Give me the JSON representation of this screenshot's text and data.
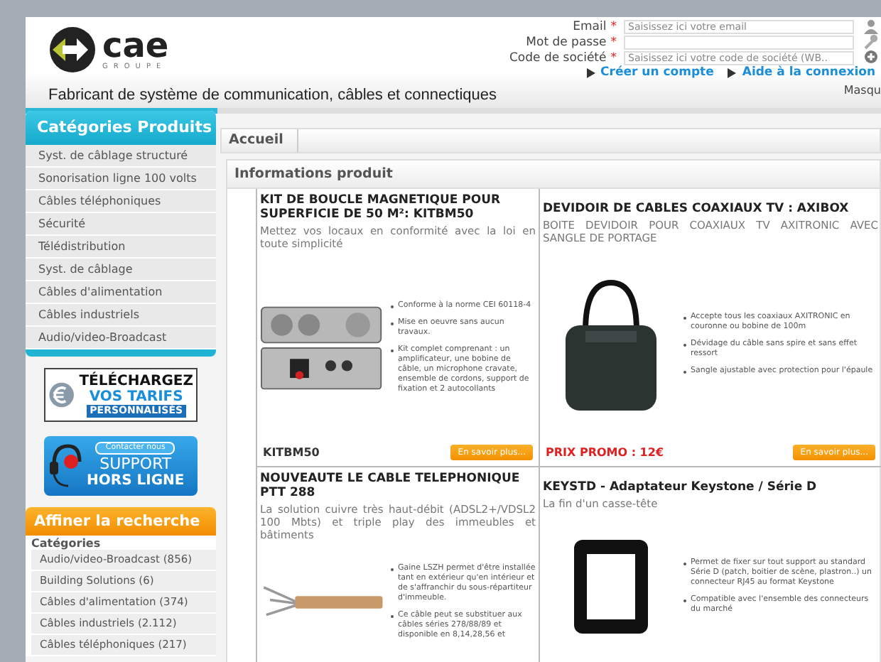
{
  "header": {
    "logo": {
      "word": "cae",
      "sub": "GROUPE"
    },
    "tagline": "Fabricant de système de communication, câbles et connectiques",
    "login": {
      "fields": [
        {
          "label": "Email",
          "mark": "*",
          "placeholder": "Saisissez ici votre email"
        },
        {
          "label": "Mot de passe",
          "mark": "*"
        },
        {
          "label": "Code de société",
          "mark": "*",
          "placeholder": "Saisissez ici votre code de société (WB.."
        }
      ],
      "links": [
        "Créer un compte",
        "Aide à la connexion"
      ]
    },
    "hide_link": "Masqu"
  },
  "sidebar": {
    "categories": {
      "title": "Catégories Produits",
      "items": [
        "Syst. de câblage structuré",
        "Sonorisation ligne 100 volts",
        "Câbles téléphoniques",
        "Sécurité",
        "Télédistribution",
        "Syst. de câblage",
        "Câbles d'alimentation",
        "Câbles industriels",
        "Audio/video-Broadcast"
      ]
    },
    "banners": [
      {
        "kind": "tarifs",
        "lines": [
          "TÉLÉCHARGEZ",
          "VOS TARIFS",
          "PERSONNALISÉS"
        ]
      },
      {
        "kind": "support",
        "lines": [
          "Contacter nous",
          "SUPPORT",
          "HORS LIGNE"
        ]
      }
    ],
    "refine": {
      "title": "Affiner la recherche",
      "section": "Catégories",
      "items": [
        "Audio/video-Broadcast (856)",
        "Building Solutions (6)",
        "Câbles d'alimentation (374)",
        "Câbles industriels (2.112)",
        "Câbles téléphoniques (217)"
      ]
    }
  },
  "content": {
    "breadcrumb": [
      "Accueil"
    ],
    "panel_title": "Informations produit",
    "products": [
      {
        "title": "KIT DE BOUCLE MAGNETIQUE POUR SUPERFICIE DE 50 M²: KITBM50",
        "subtitle": "Mettez vos locaux en conformité avec la loi en toute simplicité",
        "kind": "amplifier",
        "bullets": [
          "Conforme à la norme CEI 60118-4",
          "Mise en oeuvre sans aucun travaux.",
          "Kit complet comprenant : un amplificateur, une bobine de câble, un microphone cravate, ensemble de cordons, support de fixation et 2 autocollants"
        ],
        "code": "KITBM50",
        "button": "En savoir plus..."
      },
      {
        "title": "DEVIDOIR DE CABLES COAXIAUX TV : AXIBOX",
        "subtitle": "BOITE DEVIDOIR POUR COAXIAUX TV AXITRONIC AVEC SANGLE DE PORTAGE",
        "kind": "bag",
        "bullets": [
          "Accepte tous les coaxiaux AXITRONIC en couronne ou bobine de 100m",
          "Dévidage du câble sans spire et sans effet ressort",
          "Sangle ajustable avec protection pour l'épaule"
        ],
        "price": "PRIX PROMO : 12€",
        "button": "En savoir plus..."
      },
      {
        "title": "NOUVEAUTE LE CABLE TELEPHONIQUE PTT 288",
        "subtitle": "La solution cuivre très haut-débit (ADSL2+/VDSL2 100 Mbts) et triple play des immeubles et bâtiments",
        "kind": "cable",
        "bullets": [
          "Gaine LSZH permet d'être installée tant en extérieur qu'en intérieur et de s'affranchir du sous-répartiteur d'immeuble.",
          "Ce câble peut se substituer aux câbles séries 278/88/89 et disponible en 8,14,28,56 et"
        ]
      },
      {
        "title": "KEYSTD - Adaptateur Keystone / Série D",
        "subtitle": "La fin d'un casse-tête",
        "kind": "frame",
        "bullets": [
          "Permet de fixer sur tout support au standard Série D (patch, boitier de scène, plastron..) un connecteur RJ45 au format Keystone",
          "Compatible avec l'ensemble des connecteurs du marché"
        ]
      }
    ]
  }
}
